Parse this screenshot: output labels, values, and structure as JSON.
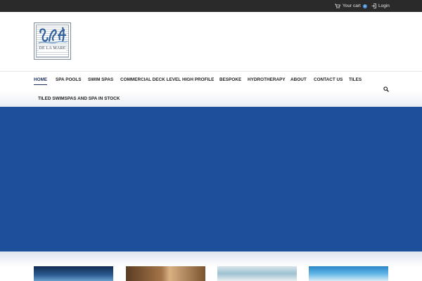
{
  "topbar": {
    "cart_label": "Your cart",
    "cart_count": "0",
    "login_label": "Login"
  },
  "logo": {
    "text": "DE LA MARE"
  },
  "nav": {
    "row1": [
      "HOME",
      "SPA POOLS",
      "SWIM SPAS",
      "COMMERCIAL DECK LEVEL",
      "HIGH PROFILE",
      "BESPOKE",
      "HYDROTHERAPY",
      "ABOUT",
      "CONTACT US",
      "TILES"
    ],
    "row2": [
      "TILED SWIMSPAS AND SPA IN STOCK"
    ]
  },
  "colors": {
    "hero": "#1d4f9b",
    "topbar": "#2a2a2a",
    "nav_active": "#1b2f5a"
  },
  "icons": [
    "cart-icon",
    "login-icon",
    "search-icon"
  ]
}
